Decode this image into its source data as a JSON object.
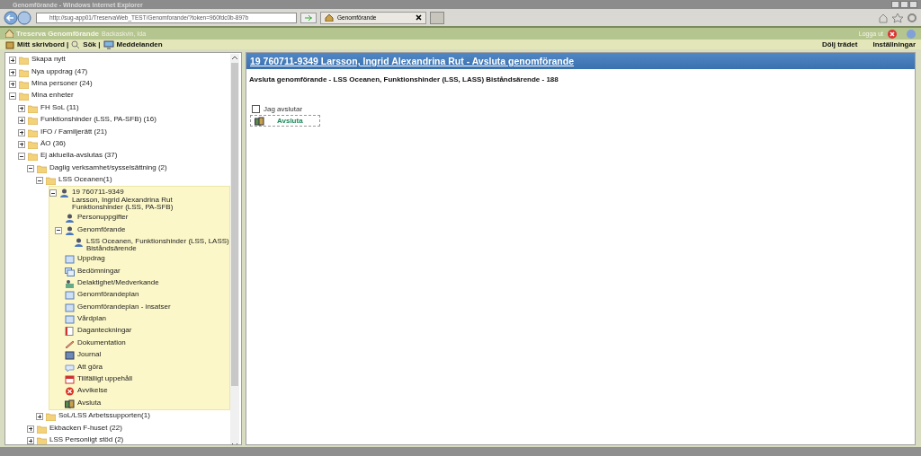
{
  "window": {
    "title": "Genomförande - Windows Internet Explorer"
  },
  "browser": {
    "address": "http://sug-app01/TreservaWeb_TEST/Genomforande/?token=960fdc0b-897b",
    "tab": "Genomförande"
  },
  "app": {
    "name": "Treserva Genomförande",
    "user": "Backaskvin, Ida",
    "logout": "Logga ut"
  },
  "toolbar": {
    "left": [
      "Mitt skrivbord |",
      "Sök |",
      "Meddelanden"
    ],
    "right": [
      "Dölj trädet",
      "Inställningar"
    ]
  },
  "tree": [
    {
      "kind": "folder",
      "lines": [
        "Skapa nytt"
      ],
      "expanded": false
    },
    {
      "kind": "folder",
      "lines": [
        "Nya uppdrag (47)"
      ],
      "expanded": false
    },
    {
      "kind": "folder",
      "lines": [
        "Mina personer (24)"
      ],
      "expanded": false
    },
    {
      "kind": "folder",
      "lines": [
        "Mina enheter"
      ],
      "expanded": true,
      "children": [
        {
          "kind": "folder",
          "lines": [
            "FH SoL (11)"
          ],
          "expanded": false
        },
        {
          "kind": "folder",
          "lines": [
            "Funktionshinder (LSS, PA-SFB) (16)"
          ],
          "expanded": false
        },
        {
          "kind": "folder",
          "lines": [
            "IFO / Familjerätt (21)"
          ],
          "expanded": false
        },
        {
          "kind": "folder",
          "lines": [
            "ÄO (36)"
          ],
          "expanded": false
        },
        {
          "kind": "folder",
          "lines": [
            "Ej aktuella-avslutas (37)"
          ],
          "expanded": true,
          "children": [
            {
              "kind": "folder",
              "lines": [
                "Daglig verksamhet/sysselsättning (2)"
              ],
              "expanded": true,
              "children": [
                {
                  "kind": "folder",
                  "lines": [
                    "LSS Oceanen(1)"
                  ],
                  "expanded": true,
                  "children": [
                    {
                      "kind": "person",
                      "lines": [
                        "19 760711-9349",
                        "Larsson, Ingrid Alexandrina Rut",
                        "Funktionshinder (LSS, PA-SFB)"
                      ],
                      "expanded": true,
                      "selected": true,
                      "children": [
                        {
                          "kind": "person",
                          "lines": [
                            "Personuppgifter"
                          ]
                        },
                        {
                          "kind": "person",
                          "lines": [
                            "Genomförande"
                          ],
                          "expanded": true,
                          "children": [
                            {
                              "kind": "person",
                              "lines": [
                                "LSS Oceanen, Funktionshinder (LSS, LASS)",
                                "Biståndsärende"
                              ]
                            }
                          ]
                        },
                        {
                          "kind": "form",
                          "lines": [
                            "Uppdrag"
                          ]
                        },
                        {
                          "kind": "forms",
                          "lines": [
                            "Bedömningar"
                          ]
                        },
                        {
                          "kind": "group",
                          "lines": [
                            "Delaktighet/Medverkande"
                          ]
                        },
                        {
                          "kind": "form",
                          "lines": [
                            "Genomförandeplan"
                          ]
                        },
                        {
                          "kind": "form",
                          "lines": [
                            "Genomförandeplan - insatser"
                          ]
                        },
                        {
                          "kind": "form",
                          "lines": [
                            "Vårdplan"
                          ]
                        },
                        {
                          "kind": "note",
                          "lines": [
                            "Daganteckningar"
                          ]
                        },
                        {
                          "kind": "pencil",
                          "lines": [
                            "Dokumentation"
                          ]
                        },
                        {
                          "kind": "journal",
                          "lines": [
                            "Journal"
                          ]
                        },
                        {
                          "kind": "speech",
                          "lines": [
                            "Att göra"
                          ]
                        },
                        {
                          "kind": "calendar",
                          "lines": [
                            "Tillfälligt uppehåll"
                          ]
                        },
                        {
                          "kind": "stop",
                          "lines": [
                            "Avvikelse"
                          ]
                        },
                        {
                          "kind": "exit",
                          "lines": [
                            "Avsluta"
                          ]
                        }
                      ]
                    }
                  ]
                },
                {
                  "kind": "folder",
                  "lines": [
                    "SoL/LSS Arbetssupporten(1)"
                  ],
                  "expanded": false
                }
              ]
            },
            {
              "kind": "folder",
              "lines": [
                "Ekbacken F-huset (22)"
              ],
              "expanded": false
            },
            {
              "kind": "folder",
              "lines": [
                "LSS Personligt stöd (2)"
              ],
              "expanded": false
            }
          ]
        }
      ]
    }
  ],
  "main": {
    "header": "19 760711-9349 Larsson, Ingrid Alexandrina Rut - Avsluta genomförande",
    "subtitle": "Avsluta genomförande - LSS Oceanen, Funktionshinder (LSS, LASS) Biståndsärende - 188",
    "checkbox": {
      "label": "Jag avslutar",
      "checked": false
    },
    "button": "Avsluta"
  }
}
